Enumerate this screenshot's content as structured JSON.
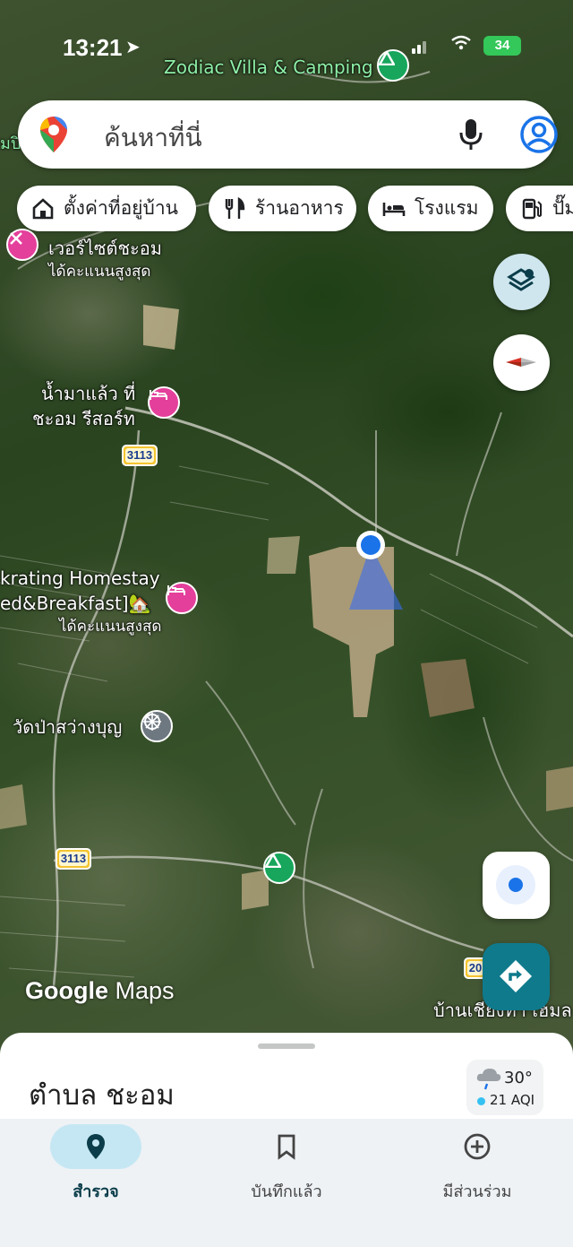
{
  "status_bar": {
    "time": "13:21",
    "battery": "34"
  },
  "search": {
    "placeholder": "ค้นหาที่นี่"
  },
  "chips": [
    {
      "label": "ตั้งค่าที่อยู่บ้าน",
      "icon": "home-icon"
    },
    {
      "label": "ร้านอาหาร",
      "icon": "restaurant-icon"
    },
    {
      "label": "โรงแรม",
      "icon": "hotel-icon"
    },
    {
      "label": "ปั๊ม",
      "icon": "gas-station-icon"
    }
  ],
  "map": {
    "places": {
      "camping_top": "Zodiac Villa & Camping",
      "partial_left": "มปิ",
      "viewpoint_name": "เวอร์ไซต์ชะอม",
      "viewpoint_sub": "ได้คะแนนสูงสุด",
      "resort_line1": "น้ำมาแล้ว ที่",
      "resort_line2": "ชะอม รีสอร์ท",
      "homestay_line1": "krating Homestay",
      "homestay_line2": "ed&Breakfast]🏡",
      "homestay_sub": "ได้คะแนนสูงสุด",
      "temple": "วัดป่าสว่างบุญ",
      "village": "บ้านเชียงทา เฮมล"
    },
    "road_shields": [
      "3113",
      "3113",
      "20"
    ],
    "logo": {
      "google": "Google",
      "maps": "Maps"
    }
  },
  "sheet": {
    "title": "ตำบล ชะอม",
    "weather": {
      "temp": "30°",
      "aqi": "21 AQI"
    }
  },
  "nav": [
    {
      "label": "สำรวจ",
      "icon": "explore-pin-icon",
      "active": true
    },
    {
      "label": "บันทึกแล้ว",
      "icon": "bookmark-icon",
      "active": false
    },
    {
      "label": "มีส่วนร่วม",
      "icon": "add-circle-icon",
      "active": false
    }
  ],
  "colors": {
    "accent": "#0f7a8c",
    "active_pill": "#c5e7f3",
    "poi_pink": "#e43f9b",
    "camp_green": "#17a65c",
    "location_blue": "#1a73e8"
  }
}
